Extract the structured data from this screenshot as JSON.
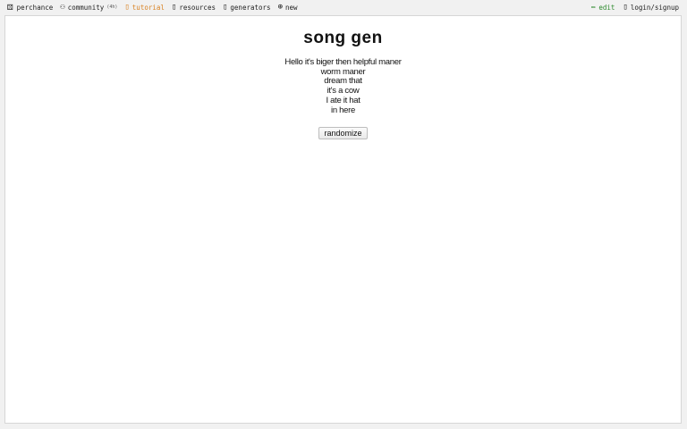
{
  "nav": {
    "brand": {
      "label": "perchance",
      "icon": "dice-icon"
    },
    "items": [
      {
        "label": "community",
        "count": "(4h)",
        "icon": "people-icon"
      },
      {
        "label": "tutorial",
        "icon": "book-icon"
      },
      {
        "label": "resources",
        "icon": "folder-icon"
      },
      {
        "label": "generators",
        "icon": "grid-icon"
      },
      {
        "label": "new",
        "icon": "plus-circle-icon"
      }
    ],
    "right": [
      {
        "label": "edit",
        "icon": "pencil-icon"
      },
      {
        "label": "login/signup",
        "icon": "user-icon"
      }
    ]
  },
  "colors": {
    "tutorial": "#d98324",
    "edit": "#2e8b2e"
  },
  "main": {
    "title": "song gen",
    "lyrics": [
      "Hello it's biger then helpful maner",
      "worm maner",
      "dream that",
      "it's a cow",
      "I ate it hat",
      "in here"
    ],
    "button_label": "randomize"
  }
}
